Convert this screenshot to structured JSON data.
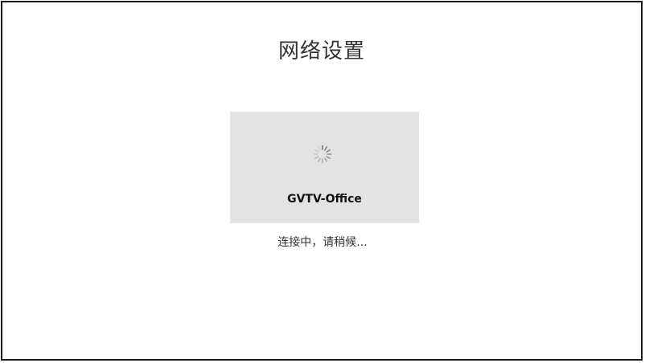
{
  "page": {
    "title": "网络设置"
  },
  "network": {
    "ssid": "GVTV-Office",
    "status": "连接中，请稍候..."
  },
  "icons": {
    "loading": "spinner-icon"
  },
  "colors": {
    "card_background": "#e3e3e3",
    "frame_border": "#1a1a1a",
    "text_primary": "#333333"
  }
}
